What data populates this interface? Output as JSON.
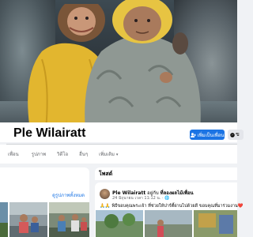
{
  "profile": {
    "name": "Ple Wilairatt",
    "follow_label": "เพิ่มเป็นเพื่อน",
    "message_label": "ข"
  },
  "tabs": [
    {
      "label": "เพื่อน"
    },
    {
      "label": "รูปภาพ"
    },
    {
      "label": "วิดีโอ"
    },
    {
      "label": "อื่นๆ"
    },
    {
      "label": "เพิ่มเติม"
    }
  ],
  "photos_card": {
    "see_all_label": "ดูรูปภาพทั้งหมด"
  },
  "feed": {
    "title": "โพสต์",
    "post": {
      "author": "Ple Wilairatt",
      "with_text": "อยู่กับ",
      "tagged": "ที่ลองผลไม้เพื่อน",
      "meta": "24 มิถุนายน เวลา 11:12 น. · 🌐",
      "text": "🙏🙏 พิธีขอบคุณพระเจ้า ที่ช่วยให้ปาร์ตี้ผ่านไปด้วยดี ขอบคุณที่มาร่วมงาน❤️"
    }
  },
  "colors": {
    "accent": "#1b74e4",
    "page_bg": "#f0f2f5",
    "text_primary": "#050505",
    "text_secondary": "#65676b"
  },
  "icons": {
    "follow": "add-friend-icon",
    "message": "messenger-icon",
    "tab_caret": "chevron-down-icon",
    "privacy": "globe-icon"
  }
}
